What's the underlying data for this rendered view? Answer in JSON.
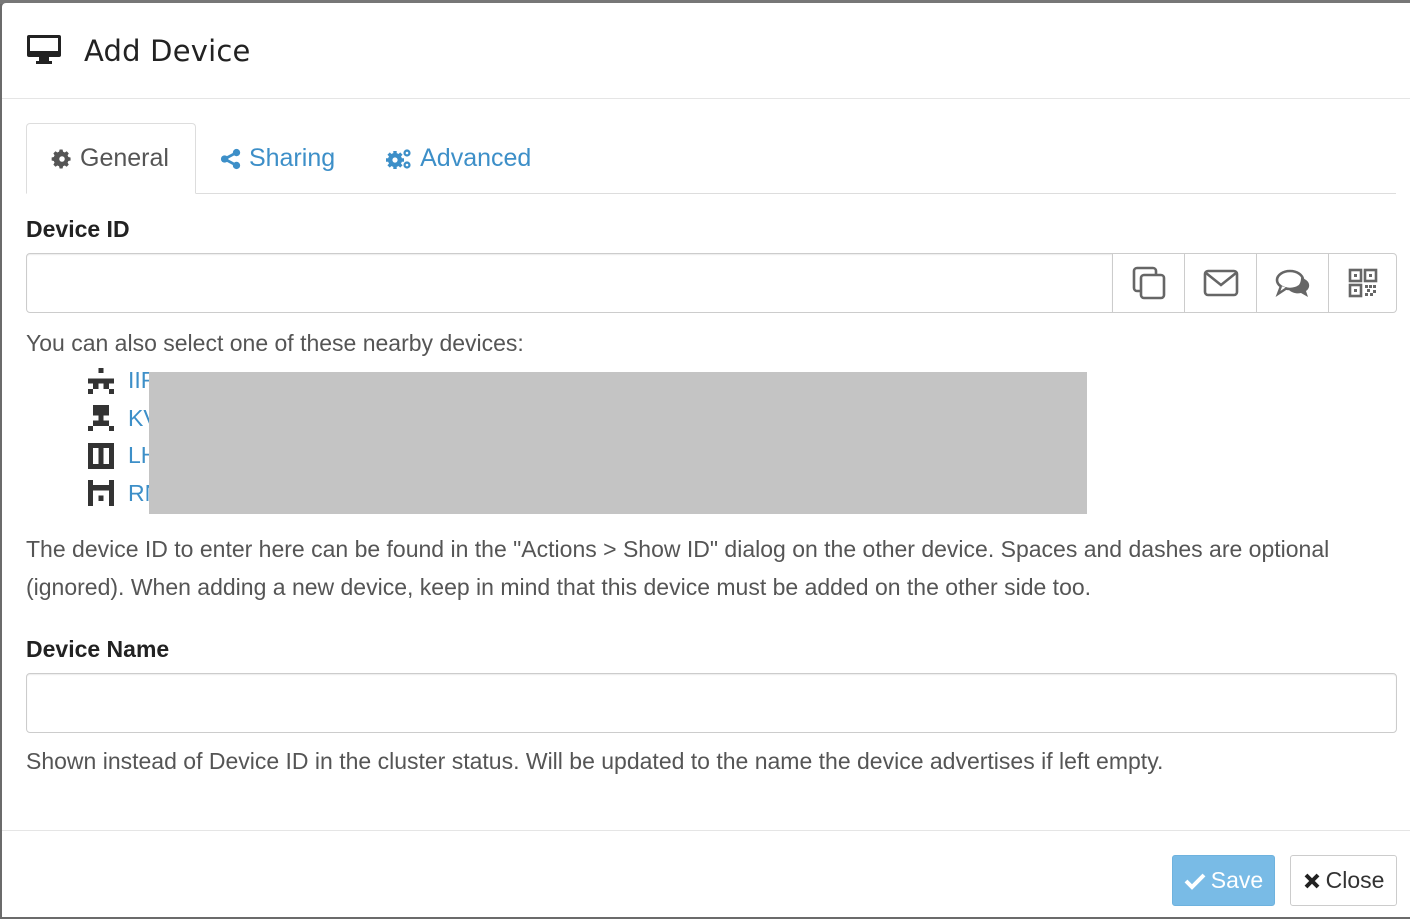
{
  "modal": {
    "title": "Add Device",
    "title_icon": "desktop-icon"
  },
  "tabs": [
    {
      "label": "General",
      "icon": "gear-icon",
      "active": true
    },
    {
      "label": "Sharing",
      "icon": "share-icon",
      "active": false
    },
    {
      "label": "Advanced",
      "icon": "gears-icon",
      "active": false
    }
  ],
  "device_id": {
    "label": "Device ID",
    "value": "",
    "placeholder": "",
    "addons": [
      {
        "name": "copy",
        "icon": "copy-icon"
      },
      {
        "name": "email",
        "icon": "envelope-icon"
      },
      {
        "name": "share-chat",
        "icon": "comments-icon"
      },
      {
        "name": "qr-code",
        "icon": "qrcode-icon"
      }
    ],
    "nearby_intro": "You can also select one of these nearby devices:",
    "nearby_devices": [
      {
        "label": "IIF",
        "icon": "identicon-icon"
      },
      {
        "label": "KV",
        "icon": "identicon-icon"
      },
      {
        "label": "LH",
        "icon": "identicon-icon"
      },
      {
        "label": "RN",
        "icon": "identicon-icon"
      }
    ],
    "help": "The device ID to enter here can be found in the \"Actions > Show ID\" dialog on the other device. Spaces and dashes are optional (ignored). When adding a new device, keep in mind that this device must be added on the other side too."
  },
  "device_name": {
    "label": "Device Name",
    "value": "",
    "placeholder": "",
    "help": "Shown instead of Device ID in the cluster status. Will be updated to the name the device advertises if left empty."
  },
  "footer": {
    "save_label": "Save",
    "close_label": "Close"
  },
  "colors": {
    "link": "#3d8fc8",
    "primary_disabled": "#79bbe6",
    "redaction": "#c4c4c4"
  }
}
